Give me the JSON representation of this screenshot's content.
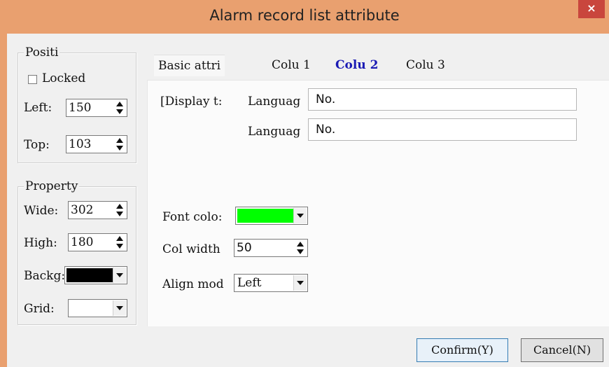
{
  "window": {
    "title": "Alarm record list attribute",
    "close_glyph": "×"
  },
  "position": {
    "group_label": "Positi",
    "locked_label": "Locked",
    "locked_checked": false,
    "left_label": "Left:",
    "left_value": "150",
    "top_label": "Top:",
    "top_value": "103"
  },
  "property": {
    "group_label": "Property",
    "wide_label": "Wide:",
    "wide_value": "302",
    "high_label": "High:",
    "high_value": "180",
    "backg_label": "Backg:",
    "backg_color": "#000000",
    "grid_label": "Grid:",
    "grid_color": "#ffffff"
  },
  "tabs": [
    {
      "label": "Basic attri",
      "active": false
    },
    {
      "label": "Colu 1",
      "active": false
    },
    {
      "label": "Colu 2",
      "active": true
    },
    {
      "label": "Colu 3",
      "active": false
    }
  ],
  "column": {
    "display_label": "[Display t:",
    "language1_label": "Languag",
    "language1_value": "No.",
    "language2_label": "Languag",
    "language2_value": "No.",
    "font_color_label": "Font colo:",
    "font_color": "#00ff00",
    "col_width_label": "Col width",
    "col_width_value": "50",
    "align_label": "Align mod",
    "align_value": "Left"
  },
  "buttons": {
    "confirm": "Confirm(Y)",
    "cancel": "Cancel(N)"
  },
  "colors": {
    "title_bar": "#e9a06f",
    "active_tab": "#1a1ab4",
    "close": "#c9463d"
  }
}
